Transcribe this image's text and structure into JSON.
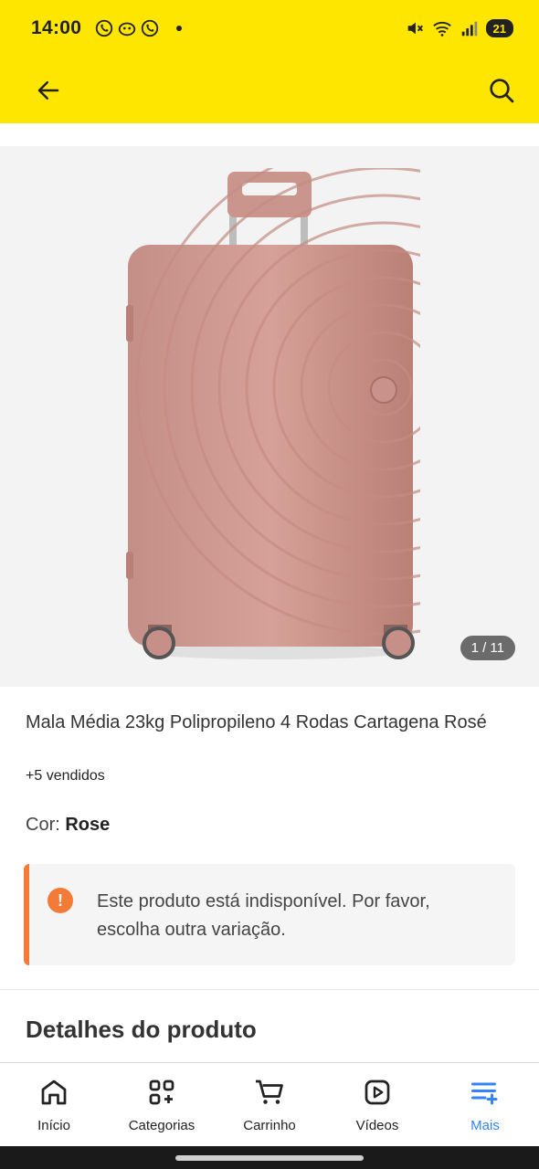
{
  "status_bar": {
    "time": "14:00",
    "battery": "21"
  },
  "gallery": {
    "counter": "1 / 11"
  },
  "product": {
    "title": "Mala Média 23kg Polipropileno 4 Rodas Cartagena Rosé",
    "sold": "+5 vendidos",
    "color_label": "Cor:",
    "color_value": "Rose"
  },
  "alert": {
    "icon": "!",
    "text": "Este produto está indisponível. Por favor, escolha outra variação."
  },
  "section": {
    "details_title": "Detalhes do produto"
  },
  "nav": {
    "items": [
      {
        "label": "Início",
        "icon": "home-icon"
      },
      {
        "label": "Categorias",
        "icon": "categories-icon"
      },
      {
        "label": "Carrinho",
        "icon": "cart-icon"
      },
      {
        "label": "Vídeos",
        "icon": "video-icon"
      },
      {
        "label": "Mais",
        "icon": "more-icon"
      }
    ]
  },
  "colors": {
    "header": "#FFE600",
    "accent": "#3483FA",
    "warning": "#F37B37"
  }
}
